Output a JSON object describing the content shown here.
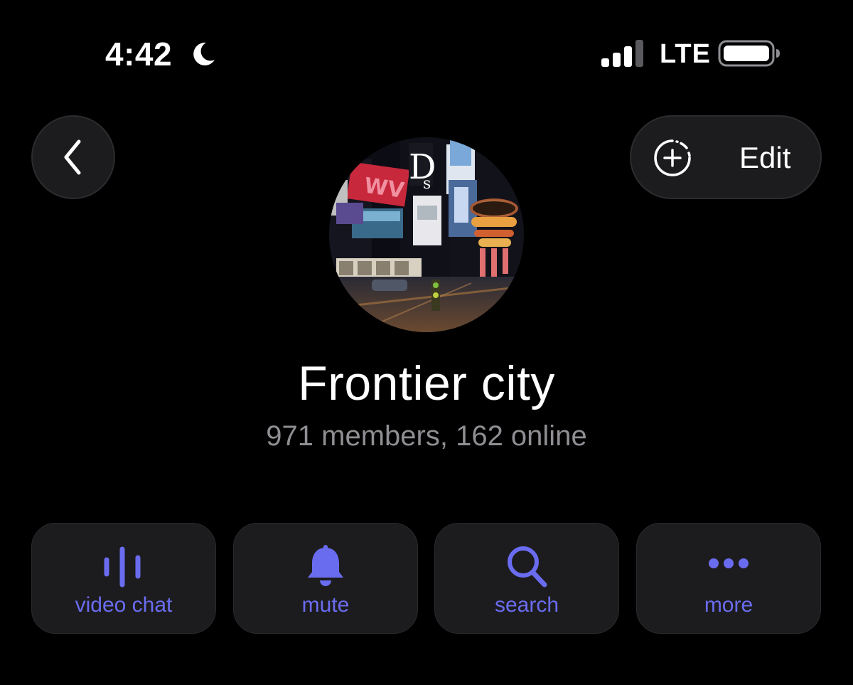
{
  "status_bar": {
    "time": "4:42",
    "network": "LTE",
    "focus_icon": "moon-icon",
    "signal_icon": "cellular-signal-icon",
    "battery_icon": "battery-icon"
  },
  "header": {
    "back_icon": "chevron-left-icon",
    "edit_label": "Edit",
    "edit_icon": "add-story-icon"
  },
  "profile": {
    "avatar": "group-avatar-city-night",
    "title": "Frontier city",
    "subtitle": "971 members, 162 online"
  },
  "actions": [
    {
      "label": "video chat",
      "icon": "voice-waveform-icon"
    },
    {
      "label": "mute",
      "icon": "bell-icon"
    },
    {
      "label": "search",
      "icon": "search-icon"
    },
    {
      "label": "more",
      "icon": "ellipsis-icon"
    }
  ],
  "colors": {
    "background": "#000000",
    "surface": "#1c1c1e",
    "accent": "#6a6cf0",
    "secondary_text": "#8e8e93",
    "primary_text": "#ffffff"
  }
}
